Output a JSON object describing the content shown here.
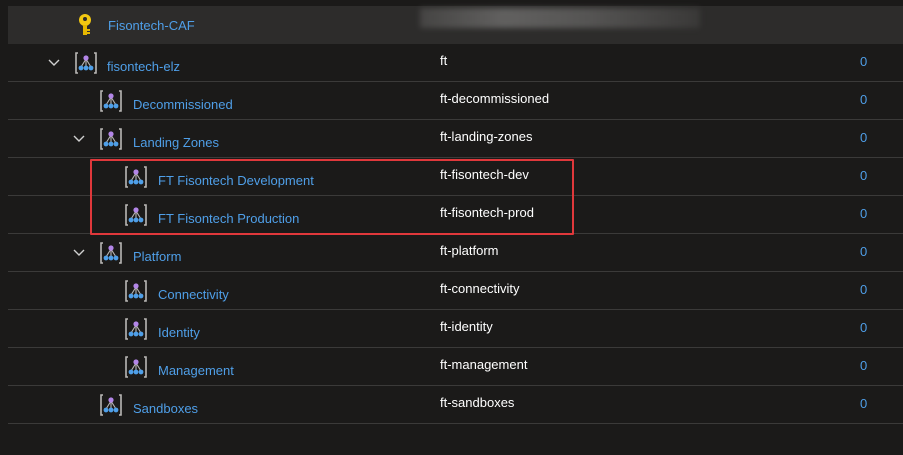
{
  "header": {
    "title": "Fisontech-CAF",
    "icon": "key-icon"
  },
  "rows": [
    {
      "name": "fisontech-elz",
      "id": "ft",
      "count": "0",
      "level": 0,
      "expanded": true
    },
    {
      "name": "Decommissioned",
      "id": "ft-decommissioned",
      "count": "0",
      "level": 1,
      "expanded": null
    },
    {
      "name": "Landing Zones",
      "id": "ft-landing-zones",
      "count": "0",
      "level": 1,
      "expanded": true
    },
    {
      "name": "FT Fisontech Development",
      "id": "ft-fisontech-dev",
      "count": "0",
      "level": 2,
      "expanded": null
    },
    {
      "name": "FT Fisontech Production",
      "id": "ft-fisontech-prod",
      "count": "0",
      "level": 2,
      "expanded": null
    },
    {
      "name": "Platform",
      "id": "ft-platform",
      "count": "0",
      "level": 1,
      "expanded": true
    },
    {
      "name": "Connectivity",
      "id": "ft-connectivity",
      "count": "0",
      "level": 2,
      "expanded": null
    },
    {
      "name": "Identity",
      "id": "ft-identity",
      "count": "0",
      "level": 2,
      "expanded": null
    },
    {
      "name": "Management",
      "id": "ft-management",
      "count": "0",
      "level": 2,
      "expanded": null
    },
    {
      "name": "Sandboxes",
      "id": "ft-sandboxes",
      "count": "0",
      "level": 1,
      "expanded": null
    }
  ],
  "colors": {
    "link": "#4f9fe8",
    "highlight": "#e0383b",
    "background": "#1b1a19"
  }
}
